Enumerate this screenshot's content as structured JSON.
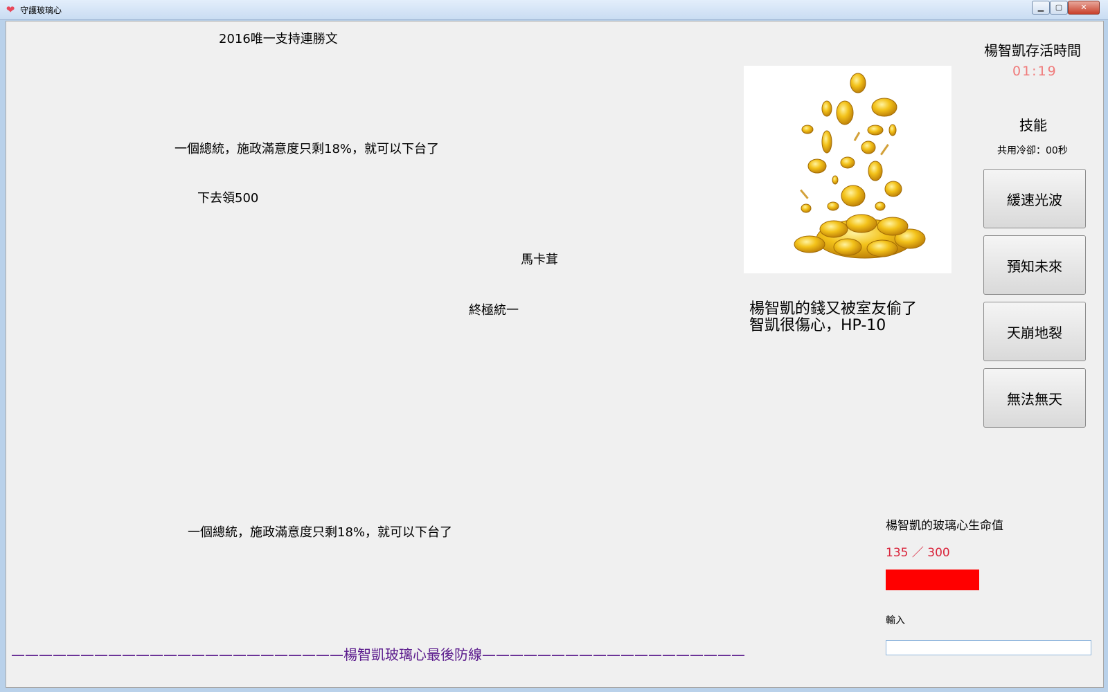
{
  "window": {
    "title": "守護玻璃心",
    "icon": "heart-icon",
    "controls": {
      "minimize": "minimize-icon",
      "maximize": "maximize-icon",
      "close": "close-icon"
    }
  },
  "falling_texts": [
    "2016唯一支持連勝文",
    "一個總統，施政滿意度只剩18%，就可以下台了",
    "下去領500",
    "馬卡茸",
    "終極統一",
    "一個總統，施政滿意度只剩18%，就可以下台了"
  ],
  "event": {
    "image_icon": "gold-coins-icon",
    "message": "楊智凱的錢又被室友偷了\n智凱很傷心，HP-10"
  },
  "timer": {
    "title": "楊智凱存活時間",
    "value": "01:19"
  },
  "skills": {
    "title": "技能",
    "cooldown": "共用冷卻：00秒",
    "buttons": [
      "緩速光波",
      "預知未來",
      "天崩地裂",
      "無法無天"
    ]
  },
  "hp": {
    "title": "楊智凱的玻璃心生命值",
    "value_text": "135 ／ 300",
    "current": 135,
    "max": 300,
    "bar_color": "#ff0000"
  },
  "input": {
    "label": "輸入",
    "value": ""
  },
  "defense_line": "————————————————————————楊智凱玻璃心最後防線———————————————————"
}
